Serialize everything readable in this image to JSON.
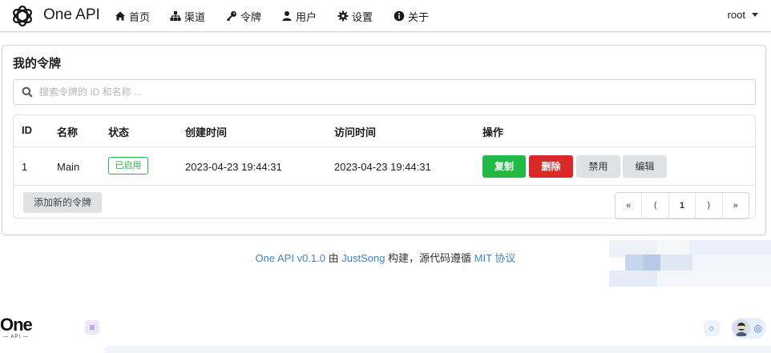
{
  "topnav": {
    "brand": "One API",
    "items": [
      {
        "label": "首页",
        "icon": "home-icon"
      },
      {
        "label": "渠道",
        "icon": "sitemap-icon"
      },
      {
        "label": "令牌",
        "icon": "key-icon"
      },
      {
        "label": "用户",
        "icon": "user-icon"
      },
      {
        "label": "设置",
        "icon": "gear-icon"
      },
      {
        "label": "关于",
        "icon": "info-icon"
      }
    ],
    "user": "root"
  },
  "page": {
    "title": "我的令牌",
    "search_placeholder": "搜索令牌的 ID 和名称 ..."
  },
  "table": {
    "headers": [
      "ID",
      "名称",
      "状态",
      "创建时间",
      "访问时间",
      "操作"
    ],
    "rows": [
      {
        "id": "1",
        "name": "Main",
        "status": "已启用",
        "created": "2023-04-23 19:44:31",
        "accessed": "2023-04-23 19:44:31",
        "actions": [
          "复制",
          "删除",
          "禁用",
          "编辑"
        ]
      }
    ]
  },
  "add_button": "添加新的令牌",
  "pagination": [
    "«",
    "⟨",
    "1",
    "⟩",
    "»"
  ],
  "footer": {
    "link1": "One API v0.1.0",
    "text1": " 由 ",
    "link2": "JustSong",
    "text2": " 构建，源代码遵循 ",
    "link3": "MIT 协议"
  },
  "second_header": {
    "logo_text": "One",
    "logo_sub": "— API —"
  },
  "colors": {
    "accent_link": "#4183c4",
    "success": "#21ba45",
    "danger": "#db2828",
    "neutral_button": "#e0e1e2"
  }
}
